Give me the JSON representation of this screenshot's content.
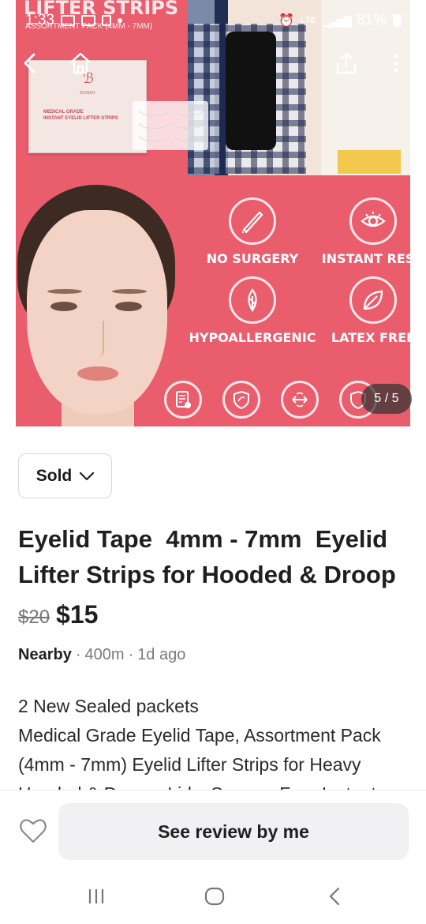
{
  "status_bar": {
    "time": "1:33",
    "network": "LTE",
    "battery": "81%"
  },
  "top_nav": {
    "back_icon": "back-arrow-icon",
    "home_icon": "home-icon",
    "share_icon": "share-icon",
    "more_icon": "more-vertical-icon"
  },
  "image": {
    "header_title": "LIFTER STRIPS",
    "header_subtitle": "ASSORTMENT PACK (4MM - 7MM)",
    "card_brand": "BUNIAO",
    "card_line1": "MEDICAL GRADE",
    "card_line2": "INSTANT EYELID LIFTER STRIPS",
    "features": [
      {
        "label": "NO SURGERY",
        "icon": "scalpel-icon"
      },
      {
        "label": "INSTANT RESU",
        "icon": "eye-icon"
      },
      {
        "label": "HYPOALLERGENIC",
        "icon": "leaf-drop-icon"
      },
      {
        "label": "LATEX FREE",
        "icon": "leaf-icon"
      }
    ],
    "photo_counter": "5 / 5",
    "accent_color": "#e95d6d"
  },
  "status_select": {
    "value": "Sold"
  },
  "listing": {
    "title": "Eyelid Tape  4mm - 7mm  Eyelid Lifter Strips for Hooded & Droop",
    "old_price": "$20",
    "price": "$15",
    "location": "Nearby",
    "distance": "400m",
    "posted": "1d ago",
    "description_lines": [
      "2 New Sealed packets",
      "Medical Grade Eyelid Tape, Assortment Pack (4mm - 7mm) Eyelid Lifter Strips for Heavy",
      "Hooded & Droopy Lids, Surgery Free Instant"
    ]
  },
  "action_bar": {
    "review_label": "See review by me",
    "like_icon": "heart-icon"
  },
  "system_nav": {
    "recents_icon": "recents-icon",
    "home_icon": "home-circle-icon",
    "back_icon": "back-chevron-icon"
  }
}
